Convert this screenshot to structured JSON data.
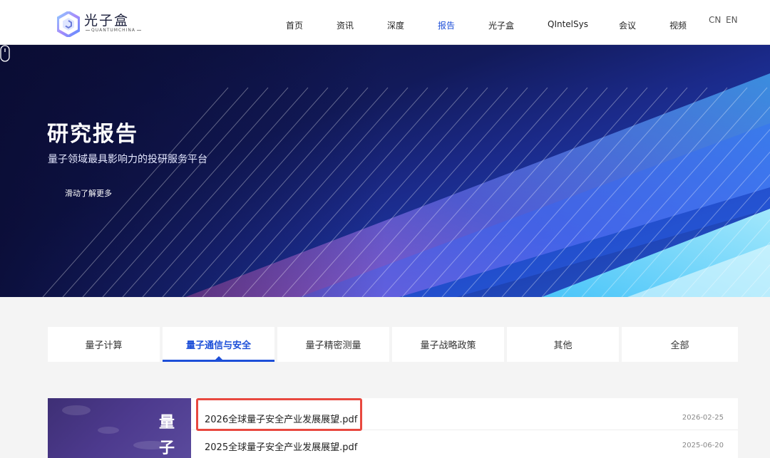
{
  "header": {
    "logo_cn": "光子盒",
    "logo_en": "QUANTUMCHINA",
    "nav": [
      "首页",
      "资讯",
      "深度",
      "报告",
      "光子盒",
      "QIntelSys",
      "会议",
      "视频"
    ],
    "active_nav": "报告",
    "lang": [
      "CN",
      "EN"
    ]
  },
  "banner": {
    "title": "研究报告",
    "subtitle": "量子领域最具影响力的投研服务平台",
    "scroll_hint": "滑动了解更多"
  },
  "tabs": {
    "items": [
      "量子计算",
      "量子通信与安全",
      "量子精密测量",
      "量子战略政策",
      "其他",
      "全部"
    ],
    "active": "量子通信与安全"
  },
  "thumbnail": {
    "chars": [
      "量",
      "子"
    ]
  },
  "reports": [
    {
      "title": "2026全球量子安全产业发展展望.pdf",
      "date": "2026-02-25",
      "highlighted": true
    },
    {
      "title": "2025全球量子安全产业发展展望.pdf",
      "date": "2025-06-20",
      "highlighted": false
    }
  ],
  "colors": {
    "accent": "#1d4fd8",
    "highlight": "#e8483f",
    "banner_dark": "#0c0f3a"
  }
}
